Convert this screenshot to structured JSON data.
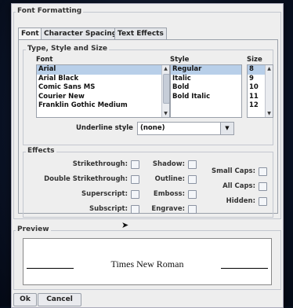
{
  "title": "Font Formatting",
  "tabs": [
    {
      "label": "Font"
    },
    {
      "label": "Character Spacing"
    },
    {
      "label": "Text Effects"
    }
  ],
  "type_style_size": {
    "group_title": "Type, Style and Size",
    "font_header": "Font",
    "style_header": "Style",
    "size_header": "Size",
    "fonts": [
      "Arial",
      "Arial Black",
      "Comic Sans MS",
      "Courier New",
      "Franklin Gothic Medium"
    ],
    "selected_font": "Arial",
    "styles": [
      "Regular",
      "Italic",
      "Bold",
      "Bold Italic"
    ],
    "selected_style": "Regular",
    "sizes": [
      "8",
      "9",
      "10",
      "11",
      "12"
    ],
    "selected_size": "8"
  },
  "underline": {
    "label": "Underline style",
    "value": "(none)"
  },
  "effects": {
    "group_title": "Effects",
    "strikethrough": "Strikethrough:",
    "double_strikethrough": "Double Strikethrough:",
    "superscript": "Superscript:",
    "subscript": "Subscript:",
    "shadow": "Shadow:",
    "outline": "Outline:",
    "emboss": "Emboss:",
    "engrave": "Engrave:",
    "small_caps": "Small Caps:",
    "all_caps": "All Caps:",
    "hidden": "Hidden:"
  },
  "preview": {
    "group_title": "Preview",
    "sample_text": "Times New Roman"
  },
  "buttons": {
    "ok": "Ok",
    "cancel": "Cancel"
  }
}
